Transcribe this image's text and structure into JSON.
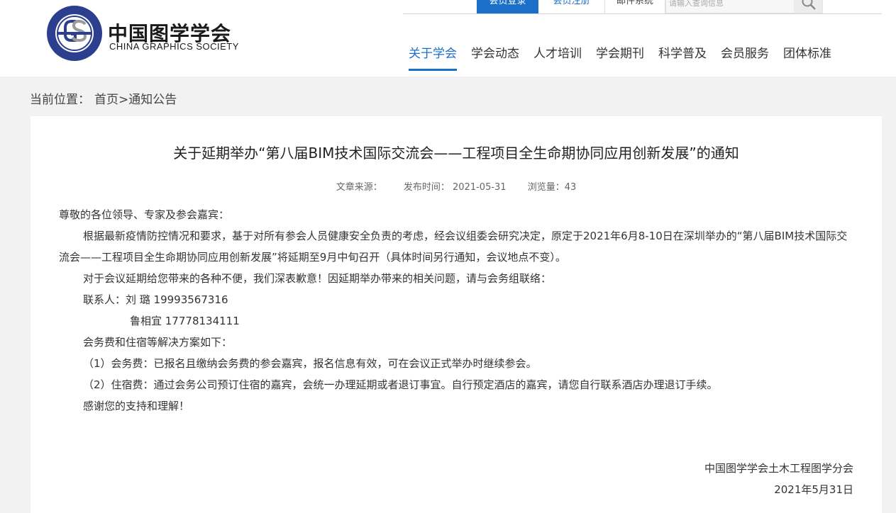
{
  "header": {
    "logo": {
      "cn": "中国图学学会",
      "en": "CHINA GRAPHICS SOCIETY",
      "emblem_top_text": "中国图学学会",
      "emblem_bottom_text": "CHINA GRAPHICS SOCIETY"
    },
    "topbar": {
      "login": "会员登录",
      "register": "会员注册",
      "mail": "邮件系统",
      "search_placeholder": "请输入查询信息",
      "search_icon": "search-icon"
    },
    "nav": [
      {
        "label": "关于学会",
        "active": true
      },
      {
        "label": "学会动态"
      },
      {
        "label": "人才培训"
      },
      {
        "label": "学会期刊"
      },
      {
        "label": "科学普及"
      },
      {
        "label": "会员服务"
      },
      {
        "label": "团体标准"
      }
    ],
    "accent_color": "#1c6fc8"
  },
  "breadcrumb": {
    "prefix": "当前位置：",
    "path": "首页>通知公告"
  },
  "article": {
    "title": "关于延期举办“第八届BIM技术国际交流会——工程项目全生命期协同应用创新发展”的通知",
    "meta": {
      "source": "文章来源：",
      "publish": "发布时间： 2021-05-31",
      "views": "浏览量：43"
    },
    "greeting": "尊敬的各位领导、专家及参会嘉宾：",
    "para1": "根据最新疫情防控情况和要求，基于对所有参会人员健康安全负责的考虑，经会议组委会研究决定，原定于2021年6月8-10日在深圳举办的“第八届BIM技术国际交流会——工程项目全生命期协同应用创新发展”将延期至9月中旬召开（具体时间另行通知，会议地点不变）。",
    "para2": "对于会议延期给您带来的各种不便，我们深表歉意！因延期举办带来的相关问题，请与会务组联络：",
    "contact1": "联系人：刘 璐 19993567316",
    "contact2": "鲁相宜 17778134111",
    "para3": "会务费和住宿等解决方案如下：",
    "item1": "（1）会务费：已报名且缴纳会务费的参会嘉宾，报名信息有效，可在会议正式举办时继续参会。",
    "item2": "（2）住宿费：通过会务公司预订住宿的嘉宾，会统一办理延期或者退订事宜。自行预定酒店的嘉宾，请您自行联系酒店办理退订手续。",
    "thanks": "感谢您的支持和理解！",
    "signature_org": "中国图学学会土木工程图学分会",
    "signature_date": "2021年5月31日"
  }
}
